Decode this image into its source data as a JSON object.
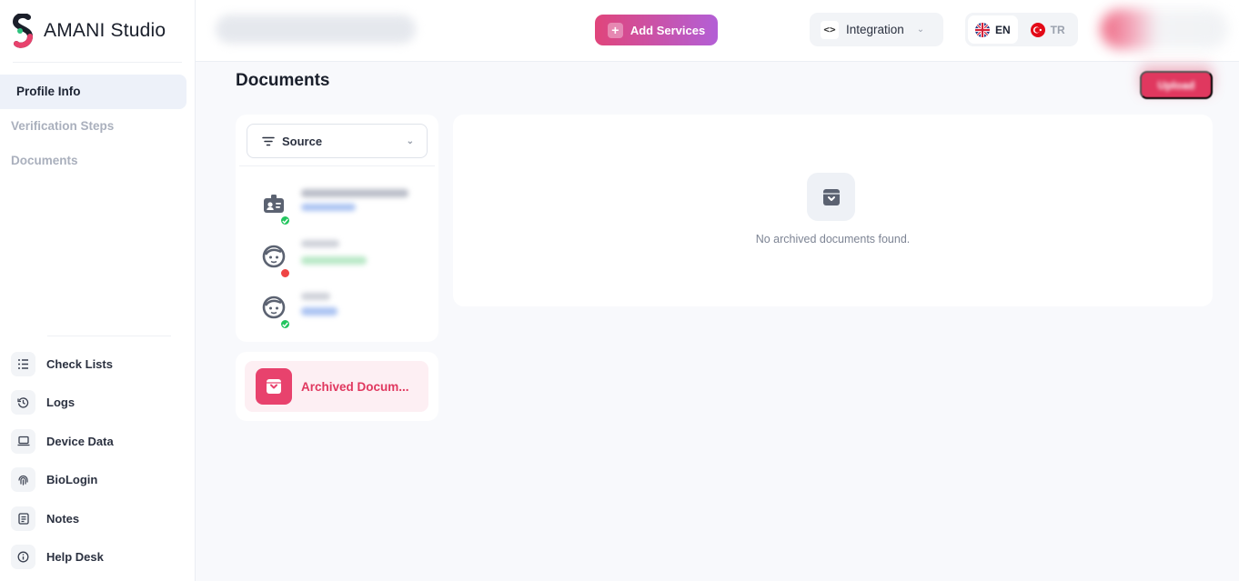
{
  "brand": {
    "name": "AMANI Studio",
    "logo": "amani-s-logo"
  },
  "sidebar": {
    "top_items": [
      {
        "label": "Profile Info",
        "active": true
      },
      {
        "label": "Verification Steps",
        "active": false
      },
      {
        "label": "Documents",
        "active": false
      }
    ],
    "bottom_items": [
      {
        "label": "Check Lists",
        "icon": "checklist-icon"
      },
      {
        "label": "Logs",
        "icon": "history-icon"
      },
      {
        "label": "Device Data",
        "icon": "laptop-icon"
      },
      {
        "label": "BioLogin",
        "icon": "fingerprint-icon"
      },
      {
        "label": "Notes",
        "icon": "note-icon"
      },
      {
        "label": "Help Desk",
        "icon": "info-icon"
      }
    ]
  },
  "header": {
    "add_services": "Add Services",
    "integration": "Integration",
    "languages": [
      {
        "code": "EN",
        "active": true
      },
      {
        "code": "TR",
        "active": false
      }
    ]
  },
  "main": {
    "title": "Documents",
    "upload_label": "Upload",
    "source_filter": "Source",
    "archived_button": "Archived Docum...",
    "empty_message": "No archived documents found.",
    "documents": [
      {
        "icon": "id-card-icon",
        "status": "verified"
      },
      {
        "icon": "face-icon",
        "status": "rejected"
      },
      {
        "icon": "face-icon",
        "status": "verified"
      }
    ]
  },
  "colors": {
    "accent": "#e0385f",
    "gradient_start": "#e0457b",
    "gradient_end": "#b35fd6",
    "success": "#22c55e",
    "error": "#ef4444"
  }
}
